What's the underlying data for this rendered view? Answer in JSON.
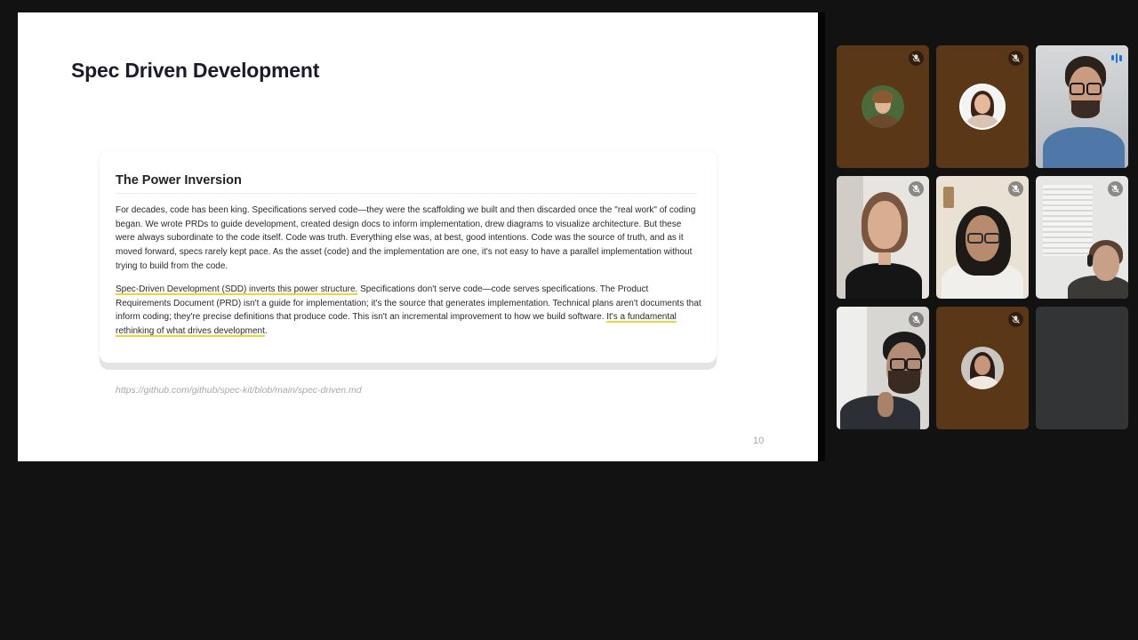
{
  "slide": {
    "title": "Spec Driven Development",
    "card": {
      "heading": "The Power Inversion",
      "paragraph1": "For decades, code has been king. Specifications served code—they were the scaffolding we built and then discarded once the \"real work\" of coding began. We wrote PRDs to guide development, created design docs to inform implementation, drew diagrams to visualize architecture. But these were always subordinate to the code itself. Code was truth. Everything else was, at best, good intentions. Code was the source of truth, and as it moved forward, specs rarely kept pace. As the asset (code) and the implementation are one, it's not easy to have a parallel implementation without trying to build from the code.",
      "paragraph2_highlight1": "Spec-Driven Development (SDD) inverts this power structure.",
      "paragraph2_body": " Specifications don't serve code—code serves specifications. The Product Requirements Document (PRD) isn't a guide for implementation; it's the source that generates implementation. Technical plans aren't documents that inform coding; they're precise definitions that produce code. This isn't an incremental improvement to how we build software. ",
      "paragraph2_highlight2": "It's a fundamental rethinking of what drives development",
      "paragraph2_end": "."
    },
    "link": "https://github.com/github/spec-kit/blob/main/spec-driven.md",
    "page_number": "10"
  },
  "participants": [
    {
      "kind": "avatar",
      "muted": true,
      "speaking": false
    },
    {
      "kind": "avatar",
      "muted": true,
      "speaking": false
    },
    {
      "kind": "video",
      "muted": false,
      "speaking": true
    },
    {
      "kind": "video",
      "muted": true,
      "speaking": false
    },
    {
      "kind": "video",
      "muted": true,
      "speaking": false
    },
    {
      "kind": "video",
      "muted": true,
      "speaking": false
    },
    {
      "kind": "video",
      "muted": true,
      "speaking": false
    },
    {
      "kind": "avatar",
      "muted": true,
      "speaking": false
    },
    {
      "kind": "empty",
      "muted": false,
      "speaking": false
    }
  ],
  "colors": {
    "meeting_background": "#121212",
    "avatar_tile": "#5a3716",
    "empty_tile": "#323436",
    "highlight_underline": "#e8dc2a",
    "speaking_outline": "#a8c7fa",
    "speaking_indicator": "#1a73e8"
  },
  "icons": {
    "muted": "mic-off-icon",
    "speaking": "audio-level-icon"
  }
}
